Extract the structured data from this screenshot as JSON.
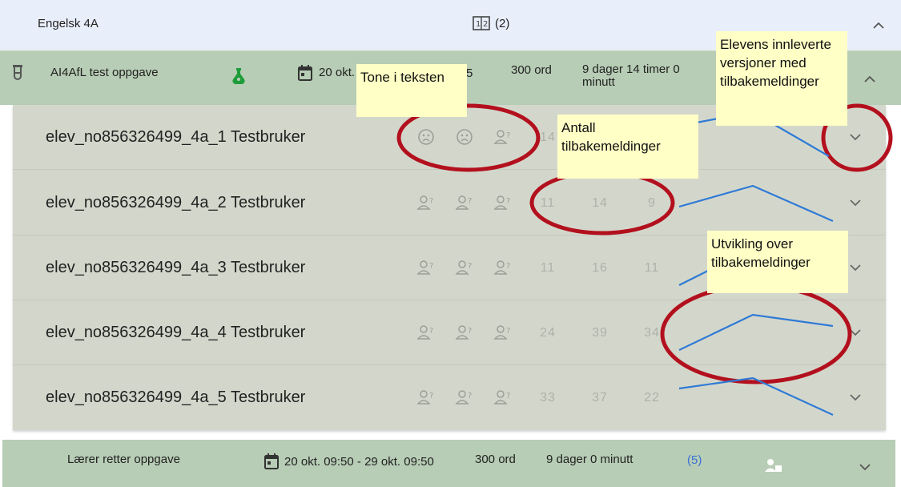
{
  "class_header": {
    "name": "Engelsk 4A",
    "count": "(2)"
  },
  "task": {
    "name": "AI4AfL test oppgave",
    "date": "20 okt.",
    "date_suffix": "5",
    "words": "300 ord",
    "time_left": "9 dager 14 timer 0 minutt"
  },
  "students": [
    {
      "name": "elev_no856326499_4a_1 Testbruker",
      "tones": [
        "face-sad-icon",
        "face-sad-icon",
        "person-question-icon"
      ],
      "counts": [
        "14",
        "",
        ""
      ]
    },
    {
      "name": "elev_no856326499_4a_2 Testbruker",
      "tones": [
        "person-question-icon",
        "person-question-icon",
        "person-question-icon"
      ],
      "counts": [
        "11",
        "14",
        "9"
      ]
    },
    {
      "name": "elev_no856326499_4a_3 Testbruker",
      "tones": [
        "person-question-icon",
        "person-question-icon",
        "person-question-icon"
      ],
      "counts": [
        "11",
        "16",
        "11"
      ]
    },
    {
      "name": "elev_no856326499_4a_4 Testbruker",
      "tones": [
        "person-question-icon",
        "person-question-icon",
        "person-question-icon"
      ],
      "counts": [
        "24",
        "39",
        "34"
      ]
    },
    {
      "name": "elev_no856326499_4a_5 Testbruker",
      "tones": [
        "person-question-icon",
        "person-question-icon",
        "person-question-icon"
      ],
      "counts": [
        "33",
        "37",
        "22"
      ]
    }
  ],
  "bottom_task": {
    "name": "Lærer retter oppgave",
    "date_range": "20 okt. 09:50 - 29 okt. 09:50",
    "words": "300 ord",
    "time_left": "9 dager 0 minutt",
    "count": "(5)",
    "count_color": "#3b6fd8"
  },
  "annotations": {
    "tone": "Tone i teksten",
    "antall": "Antall tilbakemeldinger",
    "versions": "Elevens innleverte versjoner med tilbakemeldinger",
    "utvikling": "Utvikling over tilbakemeldinger"
  },
  "colors": {
    "header_bg": "#e9eefb",
    "task_bg": "#b7cdb5",
    "student_bg": "#d3d7cb",
    "note_bg": "#ffffc6",
    "circle": "#b3101e",
    "line": "#2f7ad6"
  }
}
